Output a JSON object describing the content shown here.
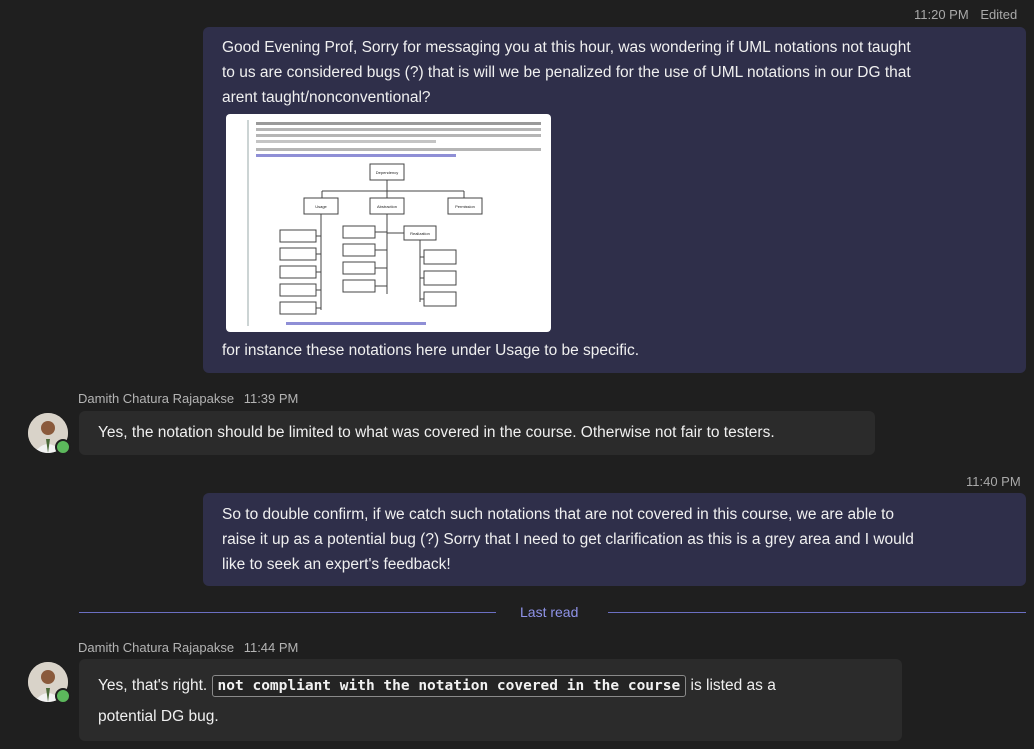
{
  "messages": {
    "m1": {
      "time": "11:20 PM",
      "edited": "Edited",
      "line1": "Good Evening Prof, Sorry for messaging you at this hour, was wondering if UML notations not taught",
      "line2": "to us are considered bugs (?) that is will we be penalized for the use of UML notations in our DG that",
      "line3": "arent taught/nonconventional?",
      "caption": "for instance these notations here under Usage to be specific."
    },
    "m2": {
      "sender": "Damith Chatura Rajapakse",
      "time": "11:39 PM",
      "text": "Yes, the notation should be limited to what was covered in the course. Otherwise not fair to testers."
    },
    "m3": {
      "time": "11:40 PM",
      "line1": "So to double confirm, if we catch such notations that are not covered in this course, we are able to",
      "line2": "raise it up as a potential bug (?) Sorry that I need to get clarification as this is a grey area and I would",
      "line3": "like to seek an expert's feedback!"
    },
    "divider": {
      "label": "Last read"
    },
    "m4": {
      "sender": "Damith Chatura Rajapakse",
      "time": "11:44 PM",
      "prefix": "Yes, that's right.",
      "code": "not compliant with the notation covered in the course",
      "suffix": "is listed as a",
      "line2": "potential DG bug."
    }
  },
  "attachment": {
    "boxes": {
      "root": "Dependency",
      "left": "Usage",
      "mid": "Abstraction",
      "right": "Permission",
      "sub": "Realization"
    }
  },
  "colors": {
    "background": "#1f1f1f",
    "my_bubble": "#2f2f4a",
    "their_bubble": "#2b2b2b",
    "accent": "#8f93e8",
    "presence": "#5cb85c"
  }
}
